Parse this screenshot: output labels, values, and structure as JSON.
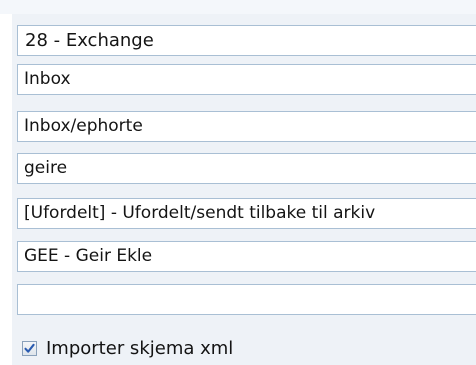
{
  "fields": [
    {
      "value": "28 - Exchange"
    },
    {
      "value": "Inbox"
    },
    {
      "value": "Inbox/ephorte"
    },
    {
      "value": "geire"
    },
    {
      "value": "[Ufordelt] - Ufordelt/sendt tilbake til arkiv"
    },
    {
      "value": "GEE - Geir Ekle"
    },
    {
      "value": ""
    }
  ],
  "import_checkbox": {
    "label": "Importer skjema xml",
    "checked": true,
    "check_icon": "checkmark-icon"
  },
  "colors": {
    "panel_background": "#eef2f7",
    "field_border": "#a9bfd4",
    "check_mark": "#2a5bb0",
    "text": "#141414"
  }
}
